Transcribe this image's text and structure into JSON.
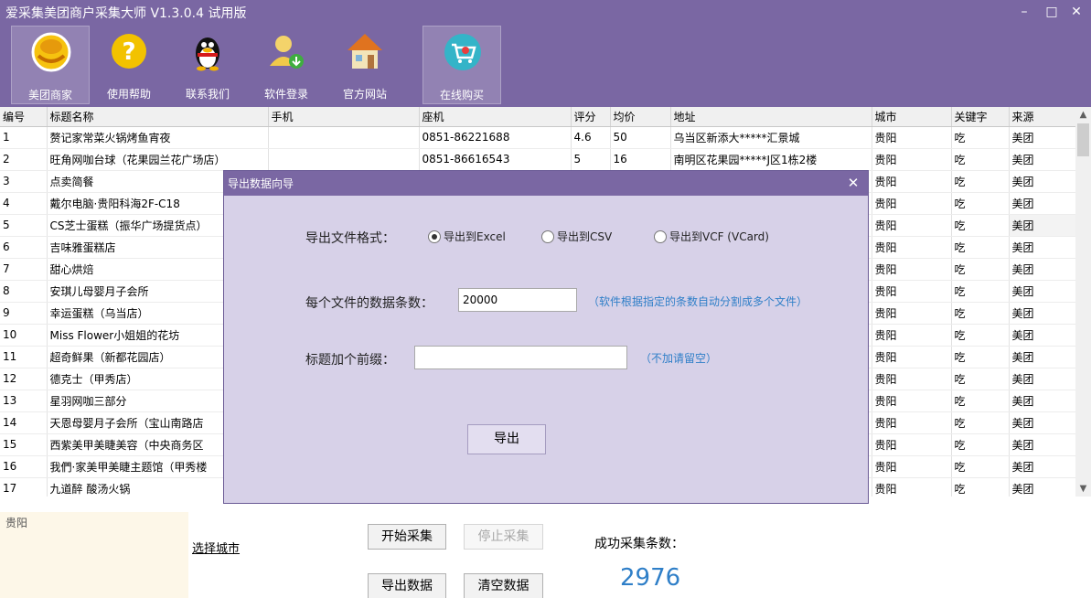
{
  "app": {
    "title": "爱采集美团商户采集大师 V1.3.0.4 试用版"
  },
  "window_controls": {
    "minimize": "–",
    "maximize": "□",
    "close": "✕"
  },
  "toolbar": [
    {
      "label": "美团商家",
      "icon": "meituan-logo-icon",
      "active": true
    },
    {
      "label": "使用帮助",
      "icon": "help-icon"
    },
    {
      "label": "联系我们",
      "icon": "qq-penguin-icon"
    },
    {
      "label": "软件登录",
      "icon": "user-login-icon"
    },
    {
      "label": "官方网站",
      "icon": "house-icon"
    },
    {
      "label": "在线购买",
      "icon": "shopping-cart-icon",
      "active": true
    }
  ],
  "table": {
    "columns": [
      "编号",
      "标题名称",
      "手机",
      "座机",
      "评分",
      "均价",
      "地址",
      "城市",
      "关键字",
      "来源"
    ],
    "rows": [
      [
        "1",
        "赘记家常菜火锅烤鱼宵夜",
        "",
        "0851-86221688",
        "4.6",
        "50",
        "乌当区新添大*****汇景城",
        "贵阳",
        "吃",
        "美团"
      ],
      [
        "2",
        "旺角网咖台球（花果园兰花广场店）",
        "",
        "0851-86616543",
        "5",
        "16",
        "南明区花果园*****J区1栋2楼",
        "贵阳",
        "吃",
        "美团"
      ],
      [
        "3",
        "点卖简餐",
        "",
        "",
        "",
        "",
        "",
        "贵阳",
        "吃",
        "美团"
      ],
      [
        "4",
        "戴尔电脑·贵阳科海2F-C18",
        "",
        "",
        "",
        "",
        "",
        "贵阳",
        "吃",
        "美团"
      ],
      [
        "5",
        "CS芝士蛋糕（振华广场提货点）",
        "",
        "",
        "",
        "",
        "",
        "贵阳",
        "吃",
        "美团"
      ],
      [
        "6",
        "吉味雅蛋糕店",
        "",
        "",
        "",
        "",
        "",
        "贵阳",
        "吃",
        "美团"
      ],
      [
        "7",
        "甜心烘焙",
        "",
        "",
        "",
        "",
        "",
        "贵阳",
        "吃",
        "美团"
      ],
      [
        "8",
        "安琪儿母婴月子会所",
        "",
        "",
        "",
        "",
        "",
        "贵阳",
        "吃",
        "美团"
      ],
      [
        "9",
        "幸运蛋糕（乌当店）",
        "",
        "",
        "",
        "",
        "",
        "贵阳",
        "吃",
        "美团"
      ],
      [
        "10",
        "Miss Flower小姐姐的花坊",
        "",
        "",
        "",
        "",
        "",
        "贵阳",
        "吃",
        "美团"
      ],
      [
        "11",
        "超奇鲜果（新都花园店）",
        "",
        "",
        "",
        "",
        "",
        "贵阳",
        "吃",
        "美团"
      ],
      [
        "12",
        "德克士（甲秀店）",
        "",
        "",
        "",
        "",
        "",
        "贵阳",
        "吃",
        "美团"
      ],
      [
        "13",
        "星羽网咖三部分",
        "",
        "",
        "",
        "",
        "",
        "贵阳",
        "吃",
        "美团"
      ],
      [
        "14",
        "天恩母婴月子会所（宝山南路店",
        "",
        "",
        "",
        "",
        "",
        "贵阳",
        "吃",
        "美团"
      ],
      [
        "15",
        "西紫美甲美睫美容（中央商务区",
        "",
        "",
        "",
        "",
        "",
        "贵阳",
        "吃",
        "美团"
      ],
      [
        "16",
        "我們·家美甲美睫主题馆（甲秀楼",
        "",
        "",
        "",
        "",
        "",
        "贵阳",
        "吃",
        "美团"
      ],
      [
        "17",
        "九道醉 酸汤火锅",
        "",
        "",
        "",
        "",
        "",
        "贵阳",
        "吃",
        "美团"
      ]
    ]
  },
  "bottom": {
    "city_value": "贵阳",
    "choose_city": "选择城市",
    "start": "开始采集",
    "stop": "停止采集",
    "export": "导出数据",
    "clear": "清空数据",
    "success_label": "成功采集条数：",
    "success_count": "2976"
  },
  "dialog": {
    "title": "导出数据向导",
    "close": "✕",
    "format_label": "导出文件格式：",
    "options": [
      {
        "label": "导出到Excel",
        "checked": true
      },
      {
        "label": "导出到CSV",
        "checked": false
      },
      {
        "label": "导出到VCF (VCard)",
        "checked": false
      }
    ],
    "per_file_label": "每个文件的数据条数：",
    "per_file_value": "20000",
    "per_file_hint": "（软件根据指定的条数自动分割成多个文件）",
    "prefix_label": "标题加个前缀：",
    "prefix_value": "",
    "prefix_hint": "（不加请留空）",
    "export_button": "导出"
  },
  "colors": {
    "titlebar": "#7a67a3",
    "dialog_bg": "#d7d1e8",
    "accent_blue": "#2f7fc8"
  }
}
